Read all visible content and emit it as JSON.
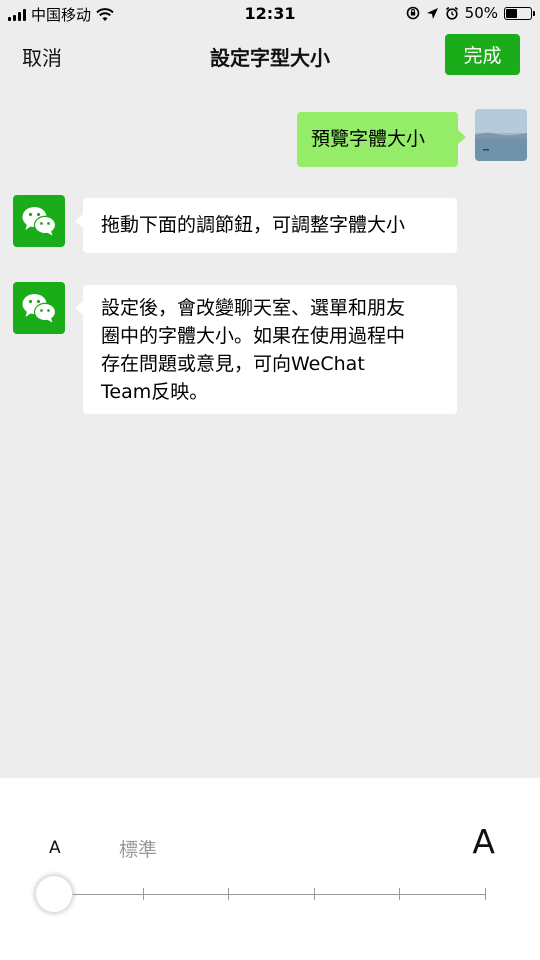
{
  "status_bar": {
    "carrier": "中国移动",
    "time": "12:31",
    "battery_percent": "50%",
    "battery_level": 0.5,
    "icons": [
      "signal-icon",
      "wifi-icon",
      "orientation-lock-icon",
      "location-icon",
      "alarm-icon",
      "battery-icon"
    ]
  },
  "navbar": {
    "cancel_label": "取消",
    "title": "設定字型大小",
    "done_label": "完成"
  },
  "chat": {
    "messages": [
      {
        "side": "right",
        "text": "預覽字體大小",
        "avatar": "landscape-photo"
      },
      {
        "side": "left",
        "text": "拖動下面的調節鈕，可調整字體大小",
        "avatar": "wechat-logo-icon"
      },
      {
        "side": "left",
        "lines": [
          "設定後，會改變聊天室、選單和朋友",
          "圈中的字體大小。如果在使用過程中",
          "存在問題或意見，可向WeChat",
          "Team反映。"
        ],
        "avatar": "wechat-logo-icon"
      }
    ]
  },
  "font_size_panel": {
    "small_label": "A",
    "current_label": "標準",
    "large_label": "A",
    "slider_steps": 6,
    "slider_position": 0
  },
  "colors": {
    "accent_green": "#1aad19",
    "bubble_green": "#95ec69",
    "background": "#ededed"
  }
}
